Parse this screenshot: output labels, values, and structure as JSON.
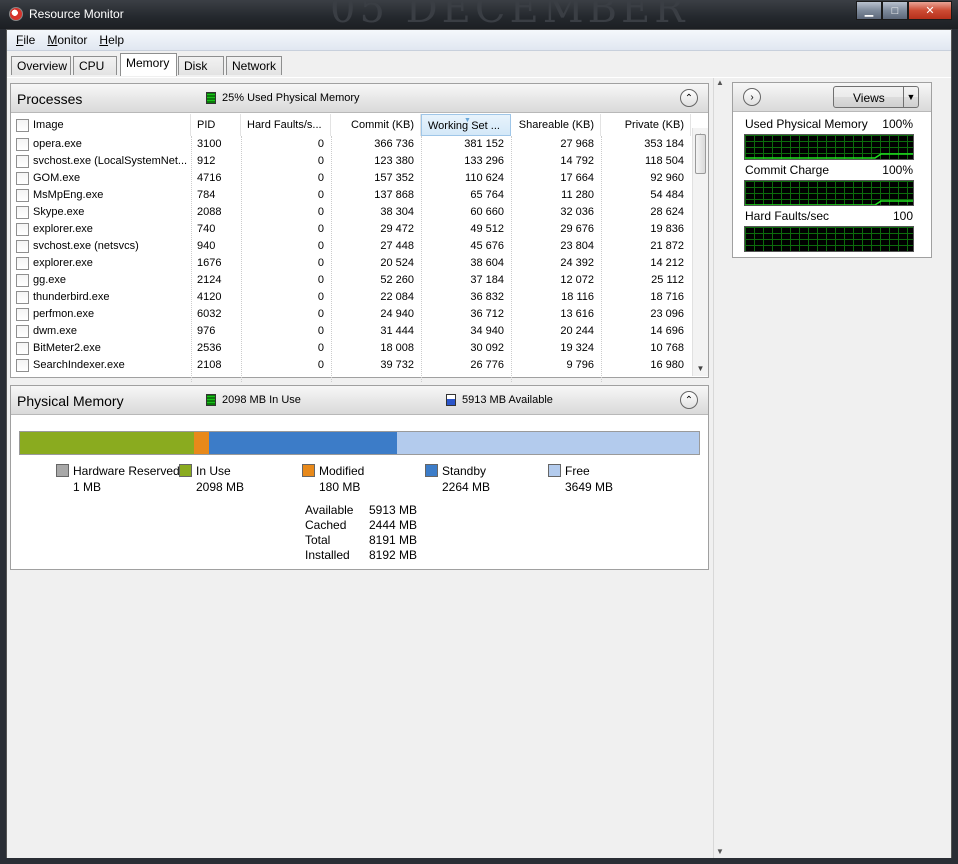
{
  "window": {
    "title": "Resource Monitor",
    "background_text": "05 DECEMBER"
  },
  "menu": [
    {
      "label": "File",
      "key": "F",
      "rest": "ile"
    },
    {
      "label": "Monitor",
      "key": "M",
      "rest": "onitor"
    },
    {
      "label": "Help",
      "key": "H",
      "rest": "elp"
    }
  ],
  "tabs": [
    "Overview",
    "CPU",
    "Memory",
    "Disk",
    "Network"
  ],
  "active_tab": "Memory",
  "processes": {
    "title": "Processes",
    "summary": "25% Used Physical Memory",
    "columns": [
      "Image",
      "PID",
      "Hard Faults/s...",
      "Commit (KB)",
      "Working Set ...",
      "Shareable (KB)",
      "Private (KB)"
    ],
    "rows": [
      [
        "opera.exe",
        "3100",
        "0",
        "366 736",
        "381 152",
        "27 968",
        "353 184"
      ],
      [
        "svchost.exe (LocalSystemNet...",
        "912",
        "0",
        "123 380",
        "133 296",
        "14 792",
        "118 504"
      ],
      [
        "GOM.exe",
        "4716",
        "0",
        "157 352",
        "110 624",
        "17 664",
        "92 960"
      ],
      [
        "MsMpEng.exe",
        "784",
        "0",
        "137 868",
        "65 764",
        "11 280",
        "54 484"
      ],
      [
        "Skype.exe",
        "2088",
        "0",
        "38 304",
        "60 660",
        "32 036",
        "28 624"
      ],
      [
        "explorer.exe",
        "740",
        "0",
        "29 472",
        "49 512",
        "29 676",
        "19 836"
      ],
      [
        "svchost.exe (netsvcs)",
        "940",
        "0",
        "27 448",
        "45 676",
        "23 804",
        "21 872"
      ],
      [
        "explorer.exe",
        "1676",
        "0",
        "20 524",
        "38 604",
        "24 392",
        "14 212"
      ],
      [
        "gg.exe",
        "2124",
        "0",
        "52 260",
        "37 184",
        "12 072",
        "25 112"
      ],
      [
        "thunderbird.exe",
        "4120",
        "0",
        "22 084",
        "36 832",
        "18 116",
        "18 716"
      ],
      [
        "perfmon.exe",
        "6032",
        "0",
        "24 940",
        "36 712",
        "13 616",
        "23 096"
      ],
      [
        "dwm.exe",
        "976",
        "0",
        "31 444",
        "34 940",
        "20 244",
        "14 696"
      ],
      [
        "BitMeter2.exe",
        "2536",
        "0",
        "18 008",
        "30 092",
        "19 324",
        "10 768"
      ],
      [
        "SearchIndexer.exe",
        "2108",
        "0",
        "39 732",
        "26 776",
        "9 796",
        "16 980"
      ]
    ]
  },
  "physical_memory": {
    "title": "Physical Memory",
    "in_use_summary": "2098 MB In Use",
    "available_summary": "5913 MB Available",
    "segments": [
      {
        "name": "Hardware Reserved",
        "value": "1 MB",
        "mb": 1,
        "color": "#a8a8a8"
      },
      {
        "name": "In Use",
        "value": "2098 MB",
        "mb": 2098,
        "color": "#8aab1f"
      },
      {
        "name": "Modified",
        "value": "180 MB",
        "mb": 180,
        "color": "#e8891a"
      },
      {
        "name": "Standby",
        "value": "2264 MB",
        "mb": 2264,
        "color": "#3c7cc8"
      },
      {
        "name": "Free",
        "value": "3649 MB",
        "mb": 3649,
        "color": "#b3cbed"
      }
    ],
    "stats": [
      {
        "label": "Available",
        "value": "5913 MB"
      },
      {
        "label": "Cached",
        "value": "2444 MB"
      },
      {
        "label": "Total",
        "value": "8191 MB"
      },
      {
        "label": "Installed",
        "value": "8192 MB"
      }
    ]
  },
  "side": {
    "views_label": "Views",
    "graphs": [
      {
        "title": "Used Physical Memory",
        "value": "100%"
      },
      {
        "title": "Commit Charge",
        "value": "100%"
      },
      {
        "title": "Hard Faults/sec",
        "value": "100"
      }
    ]
  },
  "colors": {
    "graph_line": "#1fe01f",
    "graph_grid": "#0c6b0c"
  }
}
